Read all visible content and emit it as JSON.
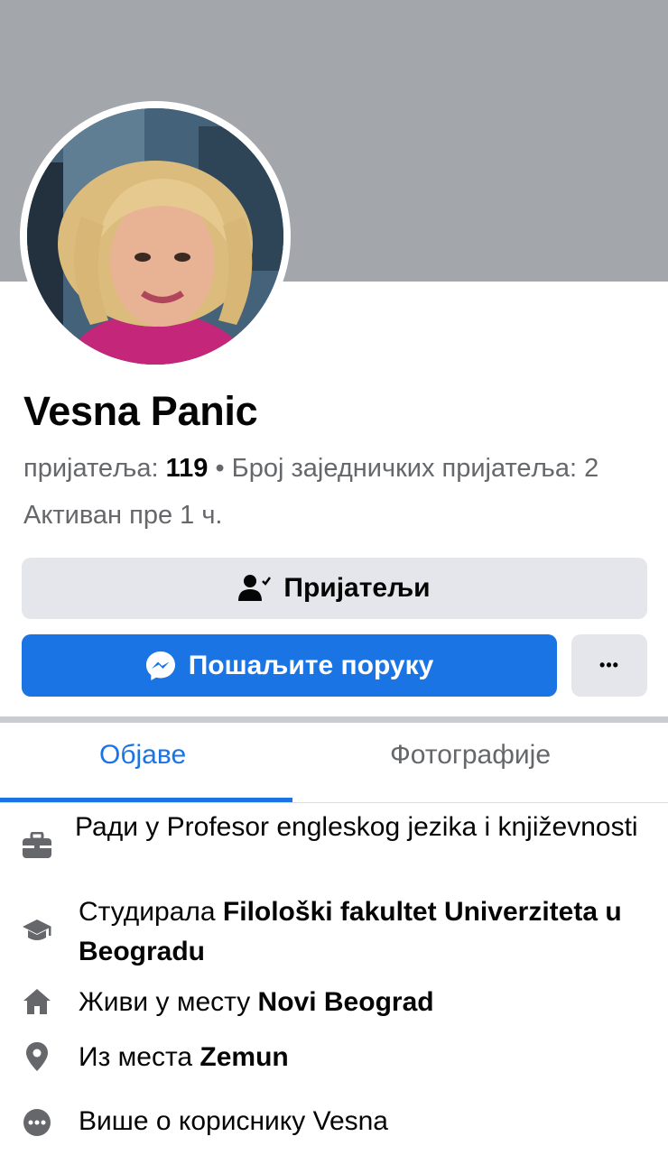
{
  "profile": {
    "name": "Vesna Panic",
    "friends_label": "пријатеља:",
    "friends_count": "119",
    "separator": "•",
    "mutual_label": "Број заједничких пријатеља: 2",
    "activity": "Активан пре 1 ч."
  },
  "actions": {
    "friends_button": "Пријатељи",
    "message_button": "Пошаљите поруку",
    "more_button": "•••"
  },
  "tabs": [
    {
      "label": "Објаве",
      "active": true
    },
    {
      "label": "Фотографије",
      "active": false
    }
  ],
  "about": {
    "work": {
      "icon": "briefcase-icon",
      "prefix": "Ради у ",
      "value": "Profesor engleskog jezika i književnosti"
    },
    "education": {
      "icon": "graduation-cap-icon",
      "prefix": "Студирала ",
      "value": "Filološki fakultet Univerziteta u Beogradu"
    },
    "lives": {
      "icon": "home-icon",
      "prefix": "Живи у месту ",
      "value": "Novi Beograd"
    },
    "from": {
      "icon": "location-pin-icon",
      "prefix": "Из места ",
      "value": "Zemun"
    },
    "more": {
      "icon": "more-dots-icon",
      "label": "Више о кориснику Vesna"
    }
  },
  "colors": {
    "accent": "#1b74e4",
    "cover": "#a3a6aa",
    "secondary_button": "#e4e6eb",
    "muted_text": "#65676b"
  }
}
